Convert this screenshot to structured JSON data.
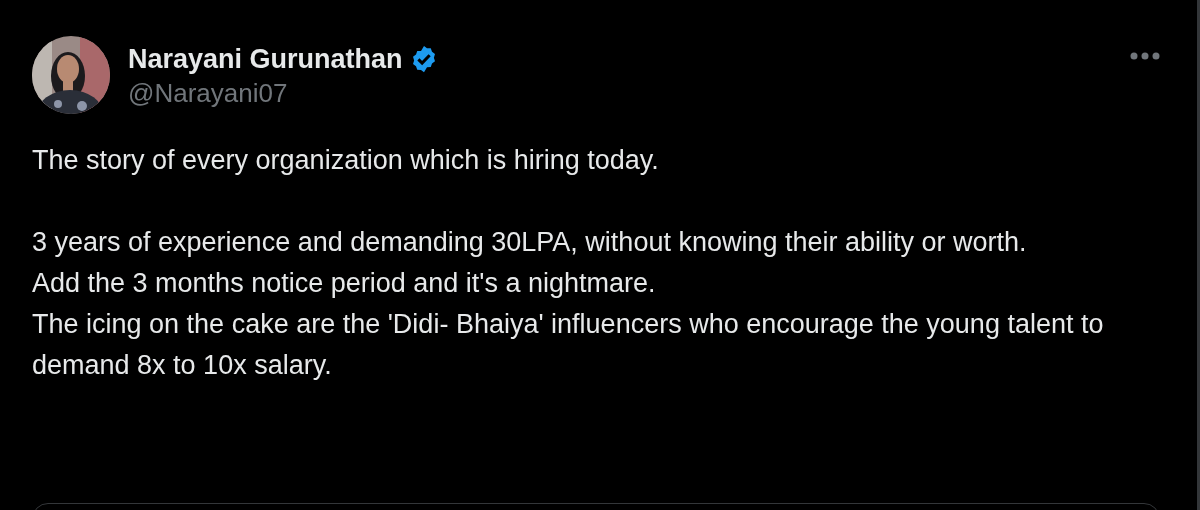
{
  "author": {
    "name": "Narayani Gurunathan",
    "verified": true,
    "handle": "@Narayani07"
  },
  "paragraphs": [
    "The story of every organization which is hiring today.",
    "3 years of experience and demanding 30LPA, without knowing their ability or worth.\nAdd the 3 months notice period and it's a nightmare.\nThe icing on the cake are the 'Didi- Bhaiya' influencers who encourage the young talent to demand 8x to 10x salary."
  ]
}
